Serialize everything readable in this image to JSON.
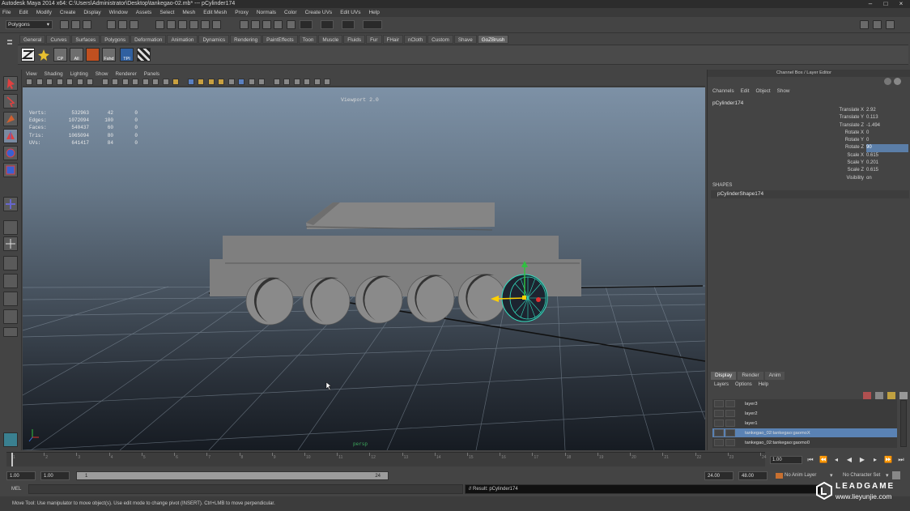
{
  "title_bar": {
    "title": "Autodesk Maya 2014 x64: C:\\Users\\Administrator\\Desktop\\tankegao-02.mb* --- pCylinder174"
  },
  "menu_bar": [
    "File",
    "Edit",
    "Modify",
    "Create",
    "Display",
    "Window",
    "Assets",
    "Select",
    "Mesh",
    "Edit Mesh",
    "Proxy",
    "Normals",
    "Color",
    "Create UVs",
    "Edit UVs",
    "Help"
  ],
  "status_line": {
    "menu_set": "Polygons"
  },
  "shelf": {
    "tabs": [
      "General",
      "Curves",
      "Surfaces",
      "Polygons",
      "Deformation",
      "Animation",
      "Dynamics",
      "Rendering",
      "PaintEffects",
      "Toon",
      "Muscle",
      "Fluids",
      "Fur",
      "FHair",
      "nCloth",
      "Custom",
      "Shave",
      "GoZBrush"
    ],
    "active_tab": "GoZBrush",
    "buttons": [
      "",
      "CP",
      "All",
      "",
      "Fshd",
      "TPI",
      ""
    ]
  },
  "viewport": {
    "menu": [
      "View",
      "Shading",
      "Lighting",
      "Show",
      "Renderer",
      "Panels"
    ],
    "label": "Viewport 2.0",
    "hud": [
      {
        "label": "Verts:",
        "value": "532963",
        "sel": "42",
        "comp": "0"
      },
      {
        "label": "Edges:",
        "value": "1072094",
        "sel": "100",
        "comp": "0"
      },
      {
        "label": "Faces:",
        "value": "540437",
        "sel": "60",
        "comp": "0"
      },
      {
        "label": "Tris:",
        "value": "1065094",
        "sel": "80",
        "comp": "0"
      },
      {
        "label": "UVs:",
        "value": "641417",
        "sel": "84",
        "comp": "0"
      }
    ],
    "bottom_label": "persp"
  },
  "channel_box": {
    "title": "Channel Box / Layer Editor",
    "menu": [
      "Channels",
      "Edit",
      "Object",
      "Show"
    ],
    "object": "pCylinder174",
    "channels": [
      {
        "label": "Translate X",
        "value": "2.92"
      },
      {
        "label": "Translate Y",
        "value": "0.113"
      },
      {
        "label": "Translate Z",
        "value": "-1.494"
      },
      {
        "label": "Rotate X",
        "value": "0"
      },
      {
        "label": "Rotate Y",
        "value": "0"
      },
      {
        "label": "Rotate Z",
        "value": "90",
        "selected": true
      },
      {
        "label": "Scale X",
        "value": "0.615"
      },
      {
        "label": "Scale Y",
        "value": "0.201"
      },
      {
        "label": "Scale Z",
        "value": "0.615"
      },
      {
        "label": "Visibility",
        "value": "on"
      }
    ],
    "shapes_header": "SHAPES",
    "shape": "pCylinderShape174"
  },
  "layer_editor": {
    "tabs": [
      "Display",
      "Render",
      "Anim"
    ],
    "active_tab": "Display",
    "menu": [
      "Layers",
      "Options",
      "Help"
    ],
    "layers": [
      {
        "name": "layer3",
        "selected": false
      },
      {
        "name": "layer2",
        "selected": false
      },
      {
        "name": "layer1",
        "selected": false
      },
      {
        "name": "tankegao_02:tankegao:gaomoX",
        "selected": true
      },
      {
        "name": "tankegao_02:tankegao:gaomo0",
        "selected": false
      }
    ]
  },
  "timeline": {
    "ticks": [
      "1",
      "2",
      "3",
      "4",
      "5",
      "6",
      "7",
      "8",
      "9",
      "10",
      "11",
      "12",
      "13",
      "14",
      "15",
      "16",
      "17",
      "18",
      "19",
      "20",
      "21",
      "22",
      "23",
      "24"
    ],
    "current_frame": "1.00"
  },
  "range": {
    "start": "1.00",
    "playback_start": "1.00",
    "slider_start": "1",
    "slider_end": "24",
    "playback_end": "24.00",
    "end": "48.00",
    "anim_layer": "No Anim Layer",
    "character": "No Character Set"
  },
  "command_line": {
    "label": "MEL",
    "result": "// Result: pCylinder174"
  },
  "help_line": "Move Tool: Use manipulator to move object(s). Use edit mode to change pivot (INSERT). Ctrl+LMB to move perpendicular.",
  "watermark": {
    "brand": "LEADGAME",
    "url": "www.lieyunjie.com"
  },
  "colors": {
    "selection": "#5a82b4",
    "manip_x": "#e03030",
    "manip_y": "#30c040",
    "manip_z": "#ffd000",
    "highlight": "#33e0c0"
  }
}
